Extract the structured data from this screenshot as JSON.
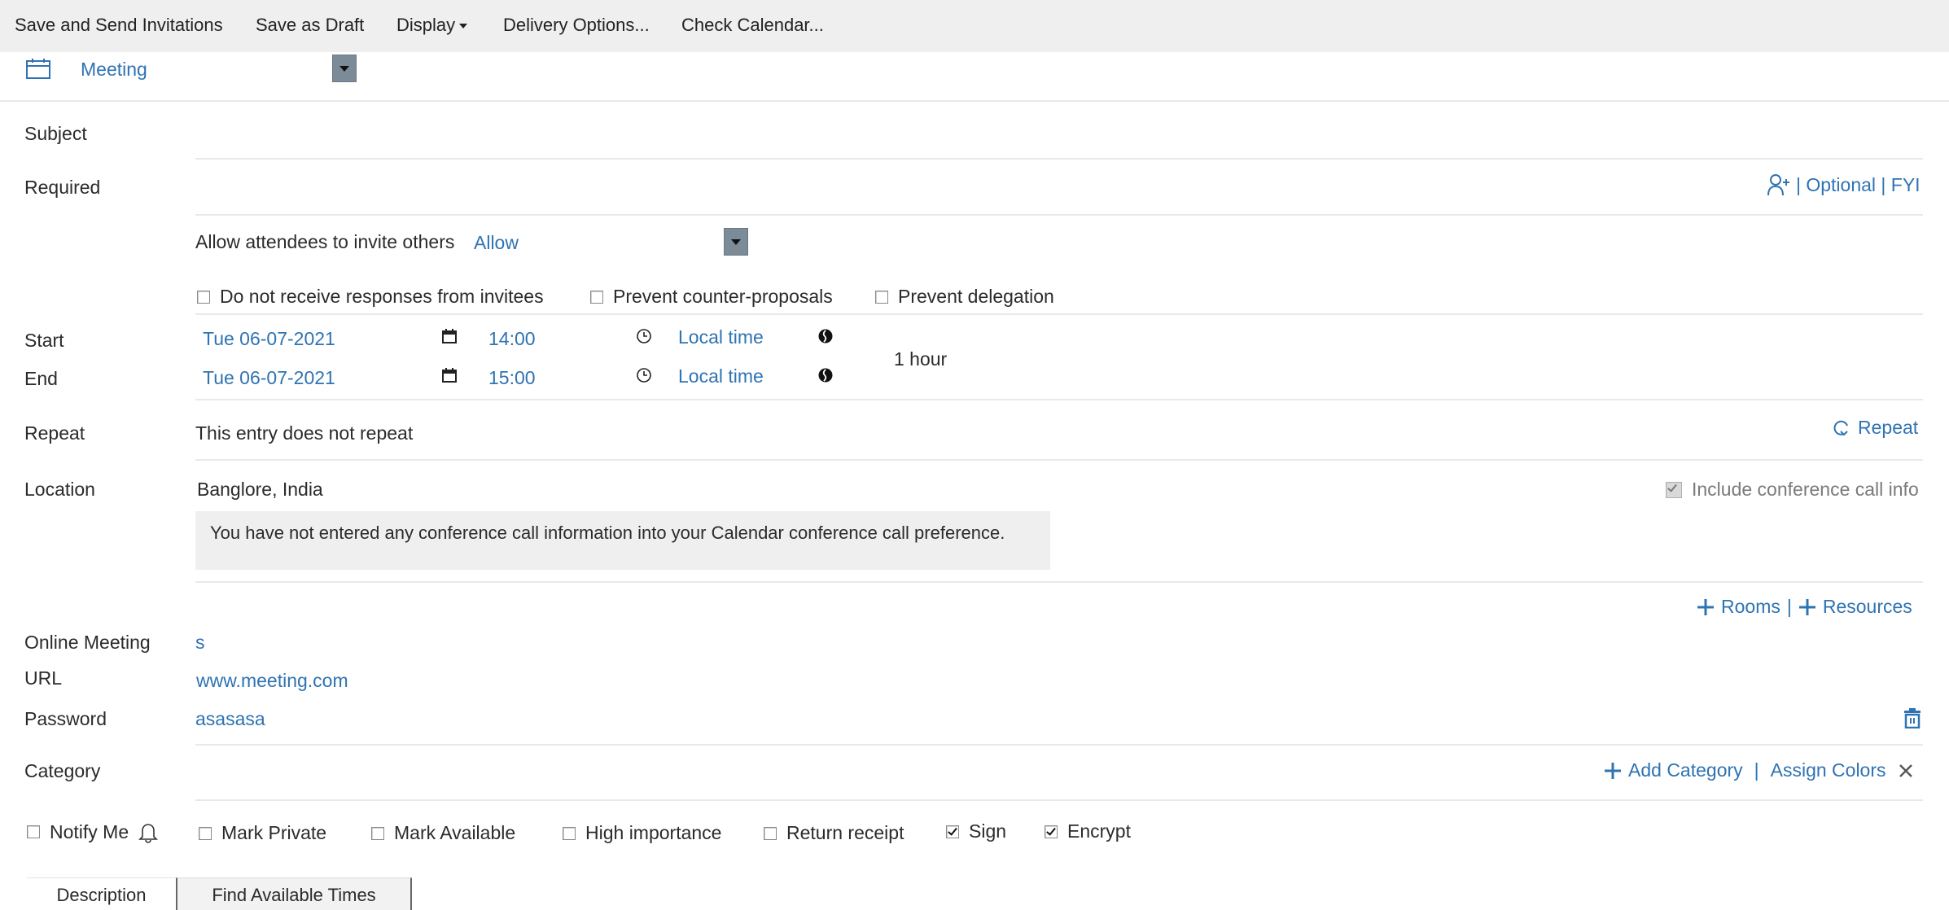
{
  "toolbar": {
    "save_send": "Save and Send Invitations",
    "save_draft": "Save as Draft",
    "display": "Display",
    "delivery_options": "Delivery Options...",
    "check_calendar": "Check Calendar..."
  },
  "entry_type": {
    "icon": "calendar-icon",
    "value": "Meeting"
  },
  "form": {
    "subject_label": "Subject",
    "subject_value": "",
    "required_label": "Required",
    "required_value": "",
    "optional_link": "| Optional | FYI",
    "allow_invite_label": "Allow attendees to invite others",
    "allow_invite_value": "Allow",
    "options": [
      {
        "label": "Do not receive responses from invitees",
        "checked": false
      },
      {
        "label": "Prevent counter-proposals",
        "checked": false
      },
      {
        "label": "Prevent delegation",
        "checked": false
      }
    ],
    "start_label": "Start",
    "start_date": "Tue 06-07-2021",
    "start_time": "14:00",
    "start_tz": "Local time",
    "end_label": "End",
    "end_date": "Tue 06-07-2021",
    "end_time": "15:00",
    "end_tz": "Local time",
    "duration": "1 hour",
    "repeat_label": "Repeat",
    "repeat_value": "This entry does not repeat",
    "repeat_link": "Repeat",
    "location_label": "Location",
    "location_value": "Banglore, India",
    "include_conf_label": "Include conference call info",
    "include_conf_checked": true,
    "conf_info": "You have not entered any conference call information into your Calendar conference call preference.",
    "rooms_link": "Rooms",
    "resources_link": "Resources",
    "rooms_sep": "|",
    "online_meeting_label": "Online Meeting",
    "online_meeting_value": "s",
    "url_label": "URL",
    "url_value": "www.meeting.com",
    "password_label": "Password",
    "password_value": "asasasa",
    "category_label": "Category",
    "add_category": "Add Category",
    "category_sep": "|",
    "assign_colors": "Assign Colors"
  },
  "flags": [
    {
      "label": "Notify Me",
      "checked": false
    },
    {
      "label": "Mark Private",
      "checked": false
    },
    {
      "label": "Mark Available",
      "checked": false
    },
    {
      "label": "High importance",
      "checked": false
    },
    {
      "label": "Return receipt",
      "checked": false
    },
    {
      "label": "Sign",
      "checked": true
    },
    {
      "label": "Encrypt",
      "checked": true
    }
  ],
  "tabs": [
    {
      "label": "Description",
      "active": true
    },
    {
      "label": "Find Available Times",
      "active": false
    }
  ],
  "colors": {
    "link_blue": "#2f73b2",
    "toolbar_bg": "#efeff0",
    "dropdown_btn": "#7b8b98"
  }
}
